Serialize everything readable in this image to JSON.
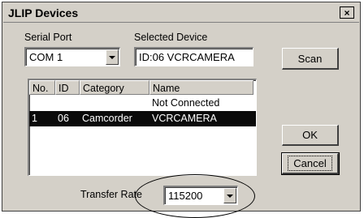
{
  "window": {
    "title": "JLIP Devices",
    "close_glyph": "×"
  },
  "serial_port": {
    "label": "Serial Port",
    "value": "COM 1"
  },
  "selected_device": {
    "label": "Selected Device",
    "value": "ID:06 VCRCAMERA"
  },
  "buttons": {
    "scan": "Scan",
    "ok": "OK",
    "cancel": "Cancel"
  },
  "device_list": {
    "columns": [
      "No.",
      "ID",
      "Category",
      "Name"
    ],
    "rows": [
      {
        "no": "",
        "id": "",
        "category": "",
        "name": "Not Connected",
        "selected": false
      },
      {
        "no": "1",
        "id": "06",
        "category": "Camcorder",
        "name": "VCRCAMERA",
        "selected": true
      }
    ]
  },
  "transfer_rate": {
    "label": "Transfer Rate",
    "value": "115200"
  },
  "icons": {
    "dropdown": "chevron-down-icon",
    "close": "close-icon"
  },
  "colors": {
    "dialog_bg": "#d4d0c8",
    "selection_bg": "#0a0a0a",
    "selection_text": "#ffffff"
  }
}
